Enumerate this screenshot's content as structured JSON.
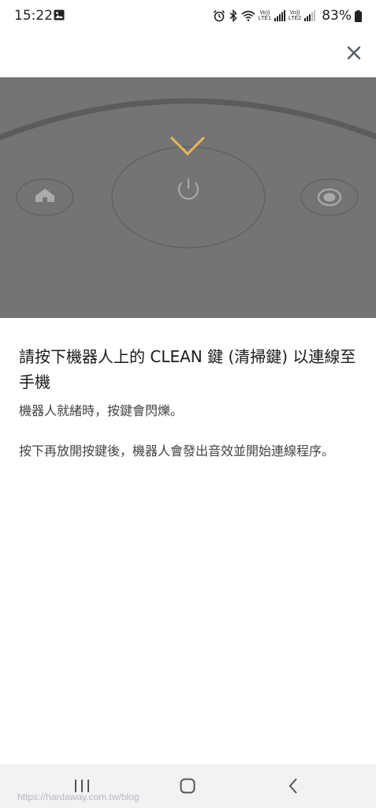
{
  "status_bar": {
    "time": "15:22",
    "battery_percent": "83%",
    "sim1_label": "LTE1",
    "sim2_label": "LTE2",
    "volte_label": "Vo))",
    "icons": [
      "gallery-icon",
      "alarm-icon",
      "bluetooth-icon",
      "wifi-icon",
      "signal-icon",
      "battery-icon"
    ]
  },
  "header": {
    "close_icon": "close-icon"
  },
  "illustration": {
    "icons": [
      "home-icon",
      "power-icon",
      "spot-clean-icon",
      "arrow-down-icon"
    ],
    "colors": {
      "background": "#737475",
      "arrow": "#e8b65a",
      "outline": "#5e5f60",
      "button_icon": "#a9aaab"
    }
  },
  "content": {
    "title": "請按下機器人上的 CLEAN 鍵 (清掃鍵) 以連線至手機",
    "paragraph_1": "機器人就緒時，按鍵會閃爍。",
    "paragraph_2": "按下再放開按鍵後，機器人會發出音效並開始連線程序。"
  },
  "nav_bar": {
    "icons": [
      "recents-icon",
      "home-button-icon",
      "back-icon"
    ],
    "watermark": "https://hardaway.com.tw/blog"
  }
}
